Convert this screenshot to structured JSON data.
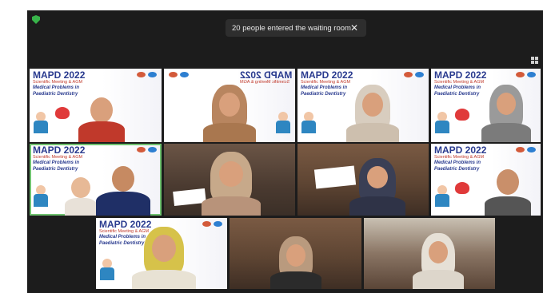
{
  "notification": {
    "message": "20 people entered the waiting room",
    "close_glyph": "✕"
  },
  "icons": {
    "security": "shield-icon",
    "view": "grid-view-icon"
  },
  "banner": {
    "event": "MAPD 2022",
    "subtitle": "Scientific Meeting & AGM",
    "topic_line1": "Medical Problems in",
    "topic_line2": "Paediatric Dentistry"
  },
  "colors": {
    "background": "#1c1c1c",
    "active_speaker_border": "#6fc26f",
    "banner_title": "#2a3b8f",
    "heart": "#e03a3a"
  }
}
